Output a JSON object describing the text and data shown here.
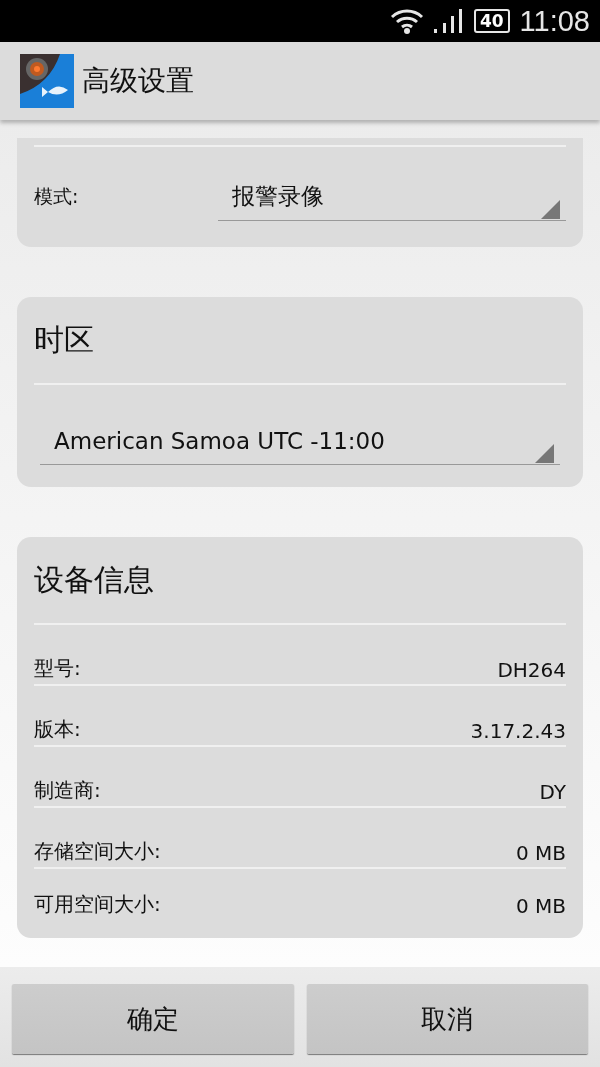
{
  "status_bar": {
    "battery": "40",
    "time": "11:08"
  },
  "app_bar": {
    "title": "高级设置"
  },
  "record_card": {
    "mode": {
      "label": "模式:",
      "value": "报警录像"
    }
  },
  "timezone_card": {
    "title": "时区",
    "value": "American Samoa UTC -11:00"
  },
  "device_info_card": {
    "title": "设备信息",
    "rows": [
      {
        "label": "型号:",
        "value": "DH264"
      },
      {
        "label": "版本:",
        "value": "3.17.2.43"
      },
      {
        "label": "制造商:",
        "value": "DY"
      },
      {
        "label": "存储空间大小:",
        "value": "0 MB"
      },
      {
        "label": "可用空间大小:",
        "value": "0 MB"
      }
    ]
  },
  "buttons": [
    "确定",
    "取消"
  ]
}
